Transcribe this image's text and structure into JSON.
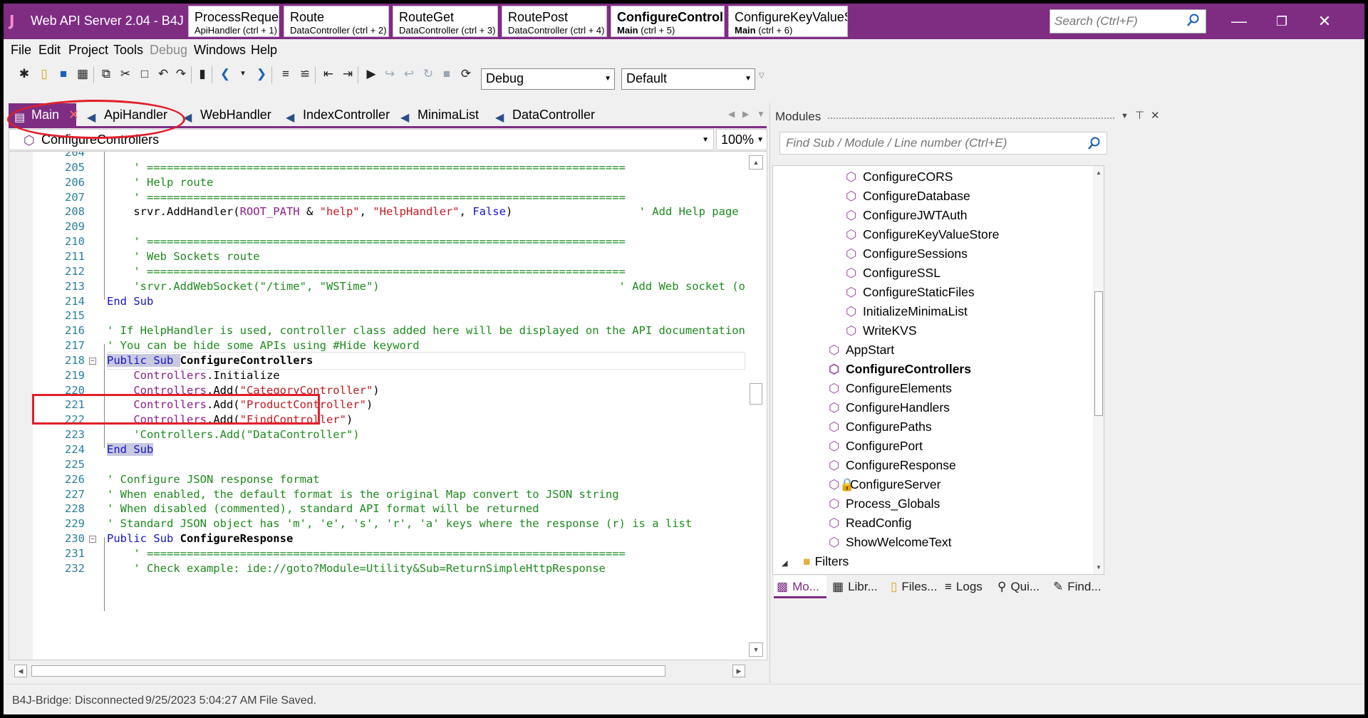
{
  "app": {
    "logo": "J",
    "title": "Web API Server 2.04 - B4J"
  },
  "quick_tabs": [
    {
      "name": "ProcessRequest",
      "sub": "ApiHandler  (ctrl + 1)",
      "active": false
    },
    {
      "name": "Route",
      "sub": "DataController  (ctrl + 2)",
      "active": false
    },
    {
      "name": "RouteGet",
      "sub": "DataController  (ctrl + 3)",
      "active": false
    },
    {
      "name": "RoutePost",
      "sub": "DataController  (ctrl + 4)",
      "active": false
    },
    {
      "name": "ConfigureControllers",
      "sub_bold": "Main",
      "sub": "  (ctrl + 5)",
      "active": true
    },
    {
      "name": "ConfigureKeyValueStore",
      "sub_bold": "Main",
      "sub": "  (ctrl + 6)",
      "active": false
    }
  ],
  "search": {
    "placeholder": "Search (Ctrl+F)"
  },
  "menu": {
    "items": [
      "File",
      "Edit",
      "Project",
      "Tools",
      "Debug",
      "Windows",
      "Help"
    ],
    "disabled": [
      "Debug"
    ]
  },
  "toolbar": {
    "build_config": "Debug",
    "target": "Default"
  },
  "doc_tabs": [
    "Main",
    "ApiHandler",
    "WebHandler",
    "IndexController",
    "MinimaList",
    "DataController"
  ],
  "sub_selector": {
    "value": "ConfigureControllers"
  },
  "zoom": {
    "value": "100%"
  },
  "code_lines": [
    {
      "n": "204",
      "segs": []
    },
    {
      "n": "205",
      "segs": [
        {
          "c": "c-com",
          "t": "    ' ========================================================================"
        }
      ]
    },
    {
      "n": "206",
      "segs": [
        {
          "c": "c-com",
          "t": "    ' Help route"
        }
      ]
    },
    {
      "n": "207",
      "segs": [
        {
          "c": "c-com",
          "t": "    ' ========================================================================"
        }
      ]
    },
    {
      "n": "208",
      "segs": [
        {
          "c": "c-txt",
          "t": "    srvr.AddHandler("
        },
        {
          "c": "c-ctl",
          "t": "ROOT_PATH"
        },
        {
          "c": "c-txt",
          "t": " & "
        },
        {
          "c": "c-str",
          "t": "\"help\""
        },
        {
          "c": "c-txt",
          "t": ", "
        },
        {
          "c": "c-str",
          "t": "\"HelpHandler\""
        },
        {
          "c": "c-txt",
          "t": ", "
        },
        {
          "c": "c-kw",
          "t": "False"
        },
        {
          "c": "c-txt",
          "t": ")                   "
        },
        {
          "c": "c-com",
          "t": "' Add Help page (optional)"
        }
      ]
    },
    {
      "n": "209",
      "segs": []
    },
    {
      "n": "210",
      "segs": [
        {
          "c": "c-com",
          "t": "    ' ========================================================================"
        }
      ]
    },
    {
      "n": "211",
      "segs": [
        {
          "c": "c-com",
          "t": "    ' Web Sockets route"
        }
      ]
    },
    {
      "n": "212",
      "segs": [
        {
          "c": "c-com",
          "t": "    ' ========================================================================"
        }
      ]
    },
    {
      "n": "213",
      "segs": [
        {
          "c": "c-com",
          "t": "    'srvr.AddWebSocket(\"/time\", \"WSTime\")                                    ' Add Web socket (optional)"
        }
      ]
    },
    {
      "n": "214",
      "segs": [
        {
          "c": "c-kw",
          "t": "End Sub"
        }
      ]
    },
    {
      "n": "215",
      "segs": []
    },
    {
      "n": "216",
      "segs": [
        {
          "c": "c-com",
          "t": "' If HelpHandler is used, controller class added here will be displayed on the API documentation page."
        }
      ]
    },
    {
      "n": "217",
      "segs": [
        {
          "c": "c-com",
          "t": "' You can be hide some APIs using #Hide keyword"
        }
      ]
    },
    {
      "n": "218",
      "segs": [
        {
          "c": "c-kw",
          "t": "Public Sub "
        },
        {
          "c": "c-txt",
          "t": "ConfigureControllers",
          "b": true
        }
      ]
    },
    {
      "n": "219",
      "segs": [
        {
          "c": "c-ctl",
          "t": "    Controllers"
        },
        {
          "c": "c-txt",
          "t": ".Initialize"
        }
      ]
    },
    {
      "n": "220",
      "segs": [
        {
          "c": "c-ctl",
          "t": "    Controllers"
        },
        {
          "c": "c-txt",
          "t": ".Add("
        },
        {
          "c": "c-str",
          "t": "\"CategoryController\""
        },
        {
          "c": "c-txt",
          "t": ")"
        }
      ]
    },
    {
      "n": "221",
      "segs": [
        {
          "c": "c-ctl",
          "t": "    Controllers"
        },
        {
          "c": "c-txt",
          "t": ".Add("
        },
        {
          "c": "c-str",
          "t": "\"ProductController\""
        },
        {
          "c": "c-txt",
          "t": ")"
        }
      ]
    },
    {
      "n": "222",
      "segs": [
        {
          "c": "c-ctl",
          "t": "    Controllers"
        },
        {
          "c": "c-txt",
          "t": ".Add("
        },
        {
          "c": "c-str",
          "t": "\"FindController\""
        },
        {
          "c": "c-txt",
          "t": ")"
        }
      ]
    },
    {
      "n": "223",
      "segs": [
        {
          "c": "c-com",
          "t": "    'Controllers.Add(\"DataController\")"
        }
      ]
    },
    {
      "n": "224",
      "segs": [
        {
          "c": "c-kw hl-sub",
          "t": "End Sub"
        }
      ]
    },
    {
      "n": "225",
      "segs": []
    },
    {
      "n": "226",
      "segs": [
        {
          "c": "c-com",
          "t": "' Configure JSON response format"
        }
      ]
    },
    {
      "n": "227",
      "segs": [
        {
          "c": "c-com",
          "t": "' When enabled, the default format is the original Map convert to JSON string"
        }
      ]
    },
    {
      "n": "228",
      "segs": [
        {
          "c": "c-com",
          "t": "' When disabled (commented), standard API format will be returned"
        }
      ]
    },
    {
      "n": "229",
      "segs": [
        {
          "c": "c-com",
          "t": "' Standard JSON object has 'm', 'e', 's', 'r', 'a' keys where the response (r) is a list"
        }
      ]
    },
    {
      "n": "230",
      "segs": [
        {
          "c": "c-kw",
          "t": "Public Sub "
        },
        {
          "c": "c-txt",
          "t": "ConfigureResponse",
          "b": true
        }
      ]
    },
    {
      "n": "231",
      "segs": [
        {
          "c": "c-com",
          "t": "    ' ========================================================================"
        }
      ]
    },
    {
      "n": "232",
      "segs": [
        {
          "c": "c-com",
          "t": "    ' Check example: ide://goto?Module=Utility&Sub=ReturnSimpleHttpResponse"
        }
      ]
    }
  ],
  "modules_panel": {
    "title": "Modules",
    "find_placeholder": "Find Sub / Module / Line number (Ctrl+E)",
    "items": [
      {
        "label": "ConfigureCORS",
        "level": 2
      },
      {
        "label": "ConfigureDatabase",
        "level": 2
      },
      {
        "label": "ConfigureJWTAuth",
        "level": 2
      },
      {
        "label": "ConfigureKeyValueStore",
        "level": 2
      },
      {
        "label": "ConfigureSessions",
        "level": 2
      },
      {
        "label": "ConfigureSSL",
        "level": 2
      },
      {
        "label": "ConfigureStaticFiles",
        "level": 2
      },
      {
        "label": "InitializeMinimaList",
        "level": 2
      },
      {
        "label": "WriteKVS",
        "level": 2
      },
      {
        "label": "AppStart",
        "level": 1
      },
      {
        "label": "ConfigureControllers",
        "level": 1,
        "bold": true
      },
      {
        "label": "ConfigureElements",
        "level": 1
      },
      {
        "label": "ConfigureHandlers",
        "level": 1
      },
      {
        "label": "ConfigurePaths",
        "level": 1
      },
      {
        "label": "ConfigurePort",
        "level": 1
      },
      {
        "label": "ConfigureResponse",
        "level": 1
      },
      {
        "label": "ConfigureServer",
        "level": 1,
        "locked": true
      },
      {
        "label": "Process_Globals",
        "level": 1
      },
      {
        "label": "ReadConfig",
        "level": 1
      },
      {
        "label": "ShowWelcomeText",
        "level": 1
      },
      {
        "label": "Filters",
        "level": 0,
        "folder": true
      }
    ],
    "tabs": [
      "Mo...",
      "Libr...",
      "Files...",
      "Logs",
      "Qui...",
      "Find..."
    ]
  },
  "status": {
    "bridge": "B4J-Bridge: Disconnected",
    "time": "9/25/2023 5:04:27 AM",
    "message": "File Saved."
  },
  "colors": {
    "accent": "#7e2d83",
    "annotation": "#e0202a"
  }
}
